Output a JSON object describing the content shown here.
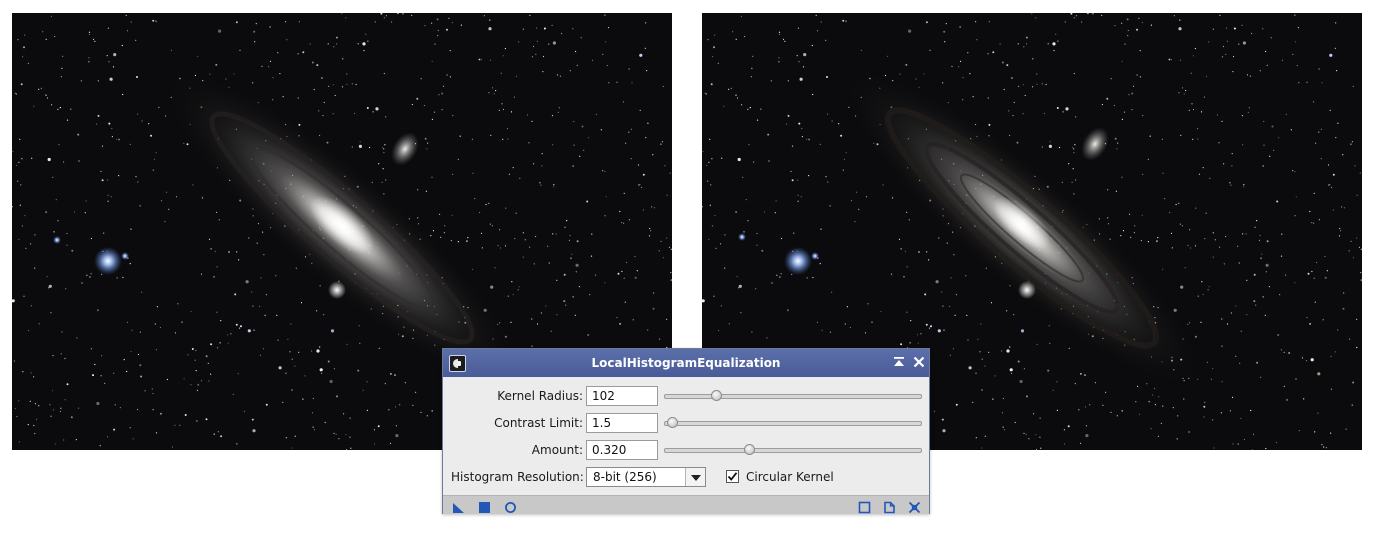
{
  "images": {
    "left": {
      "label": "Galaxy image before processing"
    },
    "right": {
      "label": "Galaxy image after processing"
    }
  },
  "dialog": {
    "title": "LocalHistogramEqualization",
    "icons": {
      "app": "process-icon",
      "shade": "shade-icon",
      "close": "close-icon",
      "new_instance": "triangle-new-instance-icon",
      "apply_global": "square-apply-global-icon",
      "real_time": "circle-real-time-preview-icon",
      "reset": "reset-square-icon",
      "browse_doc": "documentation-icon",
      "execute_collapse": "collapse-icon"
    },
    "accent_color": "#4a5c98",
    "icon_color": "#2456b8",
    "kernel_radius": {
      "label": "Kernel Radius:",
      "value": "102",
      "slider_fraction": 0.18
    },
    "contrast_limit": {
      "label": "Contrast Limit:",
      "value": "1.5",
      "slider_fraction": 0.0
    },
    "amount": {
      "label": "Amount:",
      "value": "0.320",
      "slider_fraction": 0.32
    },
    "histogram_resolution": {
      "label": "Histogram Resolution:",
      "selected": "8-bit (256)"
    },
    "circular_kernel": {
      "label": "Circular Kernel",
      "checked": true
    }
  }
}
